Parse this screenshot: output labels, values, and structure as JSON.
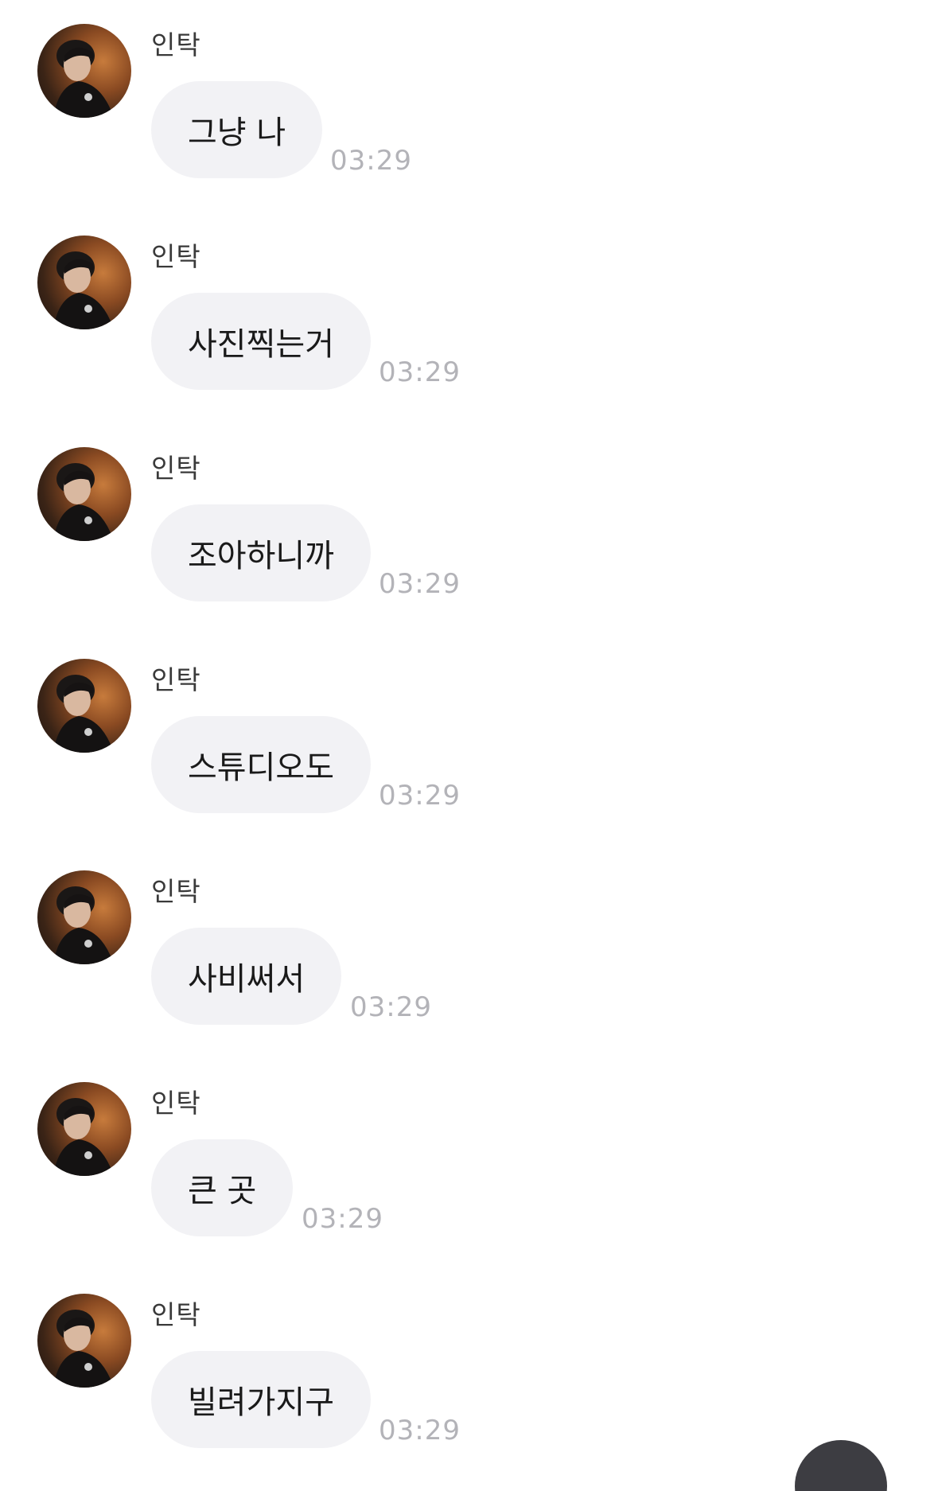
{
  "sender_name": "인탁",
  "messages": [
    {
      "text": "그냥 나",
      "time": "03:29"
    },
    {
      "text": "사진찍는거",
      "time": "03:29"
    },
    {
      "text": "조아하니까",
      "time": "03:29"
    },
    {
      "text": "스튜디오도",
      "time": "03:29"
    },
    {
      "text": "사비써서",
      "time": "03:29"
    },
    {
      "text": "큰 곳",
      "time": "03:29"
    },
    {
      "text": "빌려가지구",
      "time": "03:29"
    }
  ],
  "colors": {
    "bubble": "#f2f2f5",
    "time": "#b3b3b8",
    "fab": "#3d3d42"
  }
}
